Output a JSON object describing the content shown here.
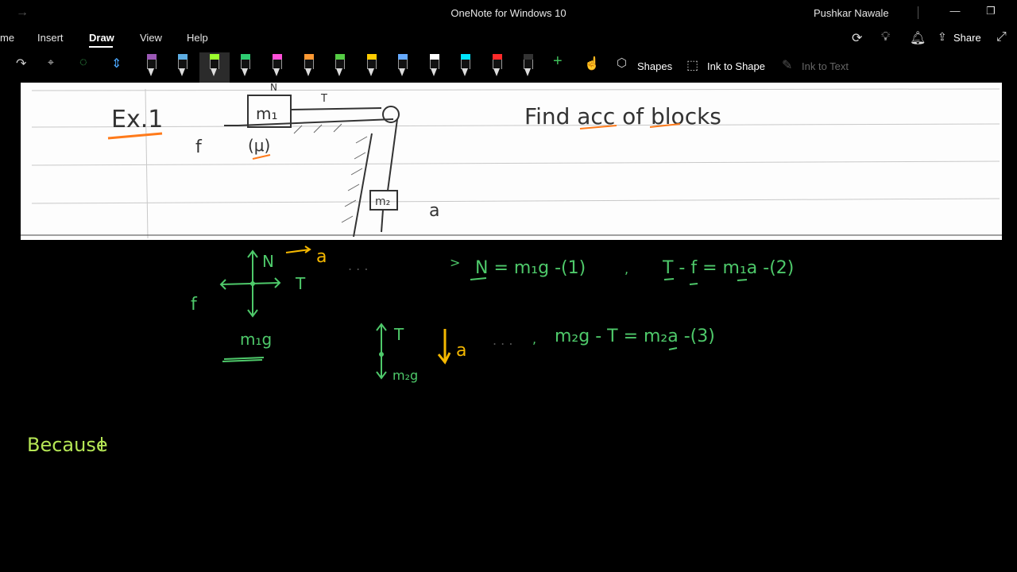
{
  "window": {
    "title": "OneNote for Windows 10",
    "user": "Pushkar Nawale"
  },
  "ribbon": {
    "tabs": [
      {
        "label": "me"
      },
      {
        "label": "Insert"
      },
      {
        "label": "Draw"
      },
      {
        "label": "View"
      },
      {
        "label": "Help"
      }
    ],
    "active_tab": "Draw",
    "share_label": "Share"
  },
  "toolbar": {
    "pens": [
      {
        "name": "pen-black-purple",
        "color": "#9b59b6"
      },
      {
        "name": "pen-blue",
        "color": "#5dade2"
      },
      {
        "name": "pen-lightgreen",
        "color": "#9cff2e"
      },
      {
        "name": "pen-green",
        "color": "#2ecc71"
      },
      {
        "name": "pen-pink",
        "color": "#ff4fd8"
      },
      {
        "name": "pen-orange",
        "color": "#ff9933"
      },
      {
        "name": "pen-green2",
        "color": "#55cc44"
      },
      {
        "name": "pen-yellow",
        "color": "#ffcc00"
      },
      {
        "name": "pen-lightblue",
        "color": "#66aaff"
      },
      {
        "name": "pen-white",
        "color": "#ffffff"
      },
      {
        "name": "highlighter-cyan",
        "color": "#00e5ff"
      },
      {
        "name": "pen-red",
        "color": "#ff2a2a"
      },
      {
        "name": "pen-black",
        "color": "#333333"
      }
    ],
    "shapes_label": "Shapes",
    "ink_to_shape_label": "Ink to Shape",
    "ink_to_text_label": "Ink to Text"
  },
  "note": {
    "paper_text": {
      "example": "Ex.1",
      "question": "Find acc of blocks",
      "f_label": "f",
      "mu_label": "(μ)",
      "m1": "m₁",
      "m2": "m₂",
      "t_label": "T",
      "n_label": "N",
      "a_label": "a"
    },
    "ink_text": {
      "fbd1_n": "N",
      "fbd1_a": "a",
      "fbd1_t": "T",
      "fbd1_f": "f",
      "fbd1_weight": "m₁g",
      "eq1": "N = m₁g  -(1)",
      "eq2": "T - f = m₁a  -(2)",
      "fbd2_t": "T",
      "fbd2_weight": "m₂g",
      "fbd2_a": "a",
      "eq3": "m₂g - T = m₂a  -(3)",
      "because": "Because"
    }
  },
  "colors": {
    "ink_green": "#4ec96a",
    "ink_yellow": "#f5b800",
    "ink_lightgreen": "#b5e655",
    "paper_ink": "#333333",
    "highlight_orange": "#ff7a1a"
  }
}
